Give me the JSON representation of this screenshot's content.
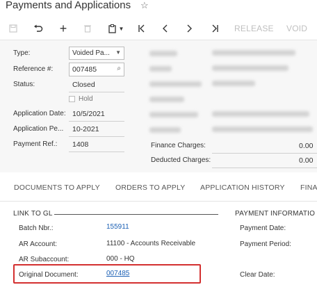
{
  "header": {
    "title": "Payments and Applications",
    "star_icon": "star-outline-icon"
  },
  "toolbar": {
    "save_icon": "save-icon",
    "undo_icon": "undo-icon",
    "add_icon": "plus-icon",
    "delete_icon": "trash-icon",
    "copy_icon": "clipboard-icon",
    "first_icon": "first-record-icon",
    "prev_icon": "previous-icon",
    "next_icon": "next-icon",
    "last_icon": "last-record-icon",
    "release_label": "RELEASE",
    "void_label": "VOID"
  },
  "form": {
    "type_label": "Type:",
    "type_value": "Voided Pa...",
    "reference_label": "Reference #:",
    "reference_value": "007485",
    "status_label": "Status:",
    "status_value": "Closed",
    "hold_label": "Hold",
    "hold_checked": false,
    "application_date_label": "Application Date:",
    "application_date_value": "10/5/2021",
    "application_period_label": "Application Pe...",
    "application_period_value": "10-2021",
    "payment_ref_label": "Payment Ref.:",
    "payment_ref_value": "1408",
    "finance_charges_label": "Finance Charges:",
    "finance_charges_value": "0.00",
    "deducted_charges_label": "Deducted Charges:",
    "deducted_charges_value": "0.00"
  },
  "tabs": [
    {
      "label": "DOCUMENTS TO APPLY"
    },
    {
      "label": "ORDERS TO APPLY"
    },
    {
      "label": "APPLICATION HISTORY"
    },
    {
      "label": "FINA"
    }
  ],
  "link_to_gl": {
    "title": "LINK TO GL",
    "batch_label": "Batch Nbr.:",
    "batch_value": "155911",
    "ar_account_label": "AR Account:",
    "ar_account_value": "11100 - Accounts Receivable",
    "ar_subaccount_label": "AR Subaccount:",
    "ar_subaccount_value": "000 - HQ",
    "original_document_label": "Original Document:",
    "original_document_value": "007485"
  },
  "payment_info": {
    "title": "PAYMENT INFORMATIO",
    "payment_date_label": "Payment Date:",
    "payment_period_label": "Payment Period:",
    "clear_date_label": "Clear Date:"
  },
  "colors": {
    "link": "#1a5fb4",
    "highlight": "#d32f2f",
    "form_bg": "#f7f7f7"
  }
}
